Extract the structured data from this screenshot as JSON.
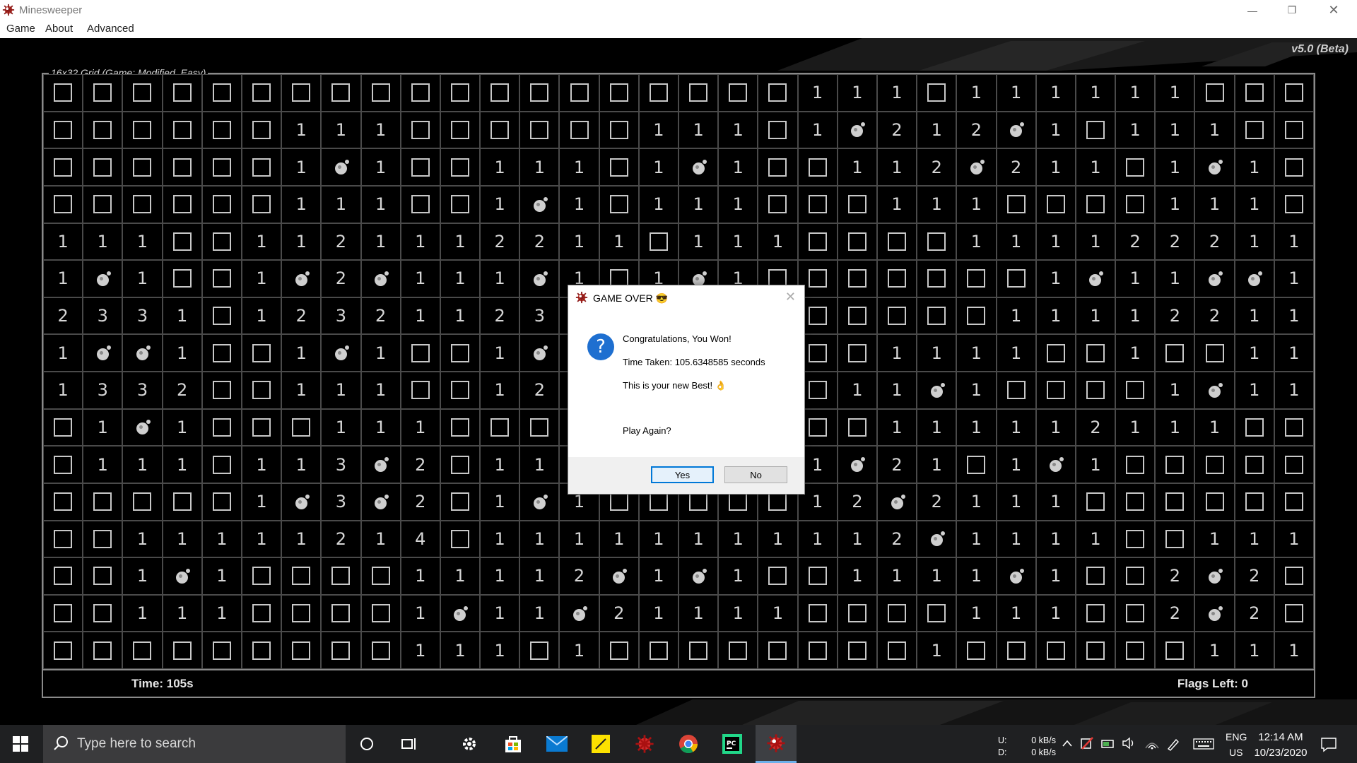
{
  "window": {
    "title": "Minesweeper",
    "menus": [
      "Game",
      "About",
      "Advanced"
    ],
    "controls": [
      "minimize",
      "restore",
      "close"
    ]
  },
  "game": {
    "version": "v5.0 (Beta)",
    "group_label": "16x32 Grid (Game: Modified, Easy)",
    "time_label": "Time: 105s",
    "flags_label": "Flags Left: 0",
    "grid_legend": {
      "#": "closed",
      "M": "mine",
      "1-3": "number"
    },
    "grid": [
      "###################111#111111####",
      "######111######111#1M212M1#111#",
      "######1M1##111#1M1##112M211#1M1#",
      "######111##1M1#111###111####111#",
      "111##1121112211#111####111122211#",
      "1M1##1M2M111M1#1M1#######1M11MM1#",
      "2331#12321123#111#######11112211#",
      "1MM1##1M1##1M1#######1111##1##11#1",
      "1332##111##12#######11M1####1M11",
      "#1M1###111###########111112111##111",
      "#111#113M2#11######1M21#1M1#####",
      "#####1M3M2#1M1#####12M2111######",
      "##11111214#11111111112M1111##111",
      "##1M1####11112M1M1##1111M1##2M2",
      "##111####1M11M21111####111##2M2",
      "#########111#1########1######111"
    ]
  },
  "dialog": {
    "title": "GAME OVER 😎",
    "lines": [
      "Congratulations, You Won!",
      "Time Taken: 105.6348585 seconds",
      "This is your new Best! 👌",
      "Play Again?"
    ],
    "buttons": {
      "yes": "Yes",
      "no": "No"
    }
  },
  "taskbar": {
    "search_placeholder": "Type here to search",
    "net_upload_label": "U:",
    "net_download_label": "D:",
    "net_upload": "0 kB/s",
    "net_download": "0 kB/s",
    "lang_1": "ENG",
    "lang_2": "US",
    "time": "12:14 AM",
    "date": "10/23/2020",
    "pinned_icons": [
      "task-view-circle-icon",
      "task-view-icon",
      "settings-icon",
      "store-icon",
      "mail-icon",
      "sticky-notes-icon",
      "minesweeper-icon",
      "chrome-icon",
      "pycharm-icon",
      "minesweeper-active-icon"
    ]
  },
  "colors": {
    "accent": "#0078d7",
    "taskbar": "#1f2022",
    "board_bg": "#000000",
    "cell_line": "#c8c8c8"
  }
}
